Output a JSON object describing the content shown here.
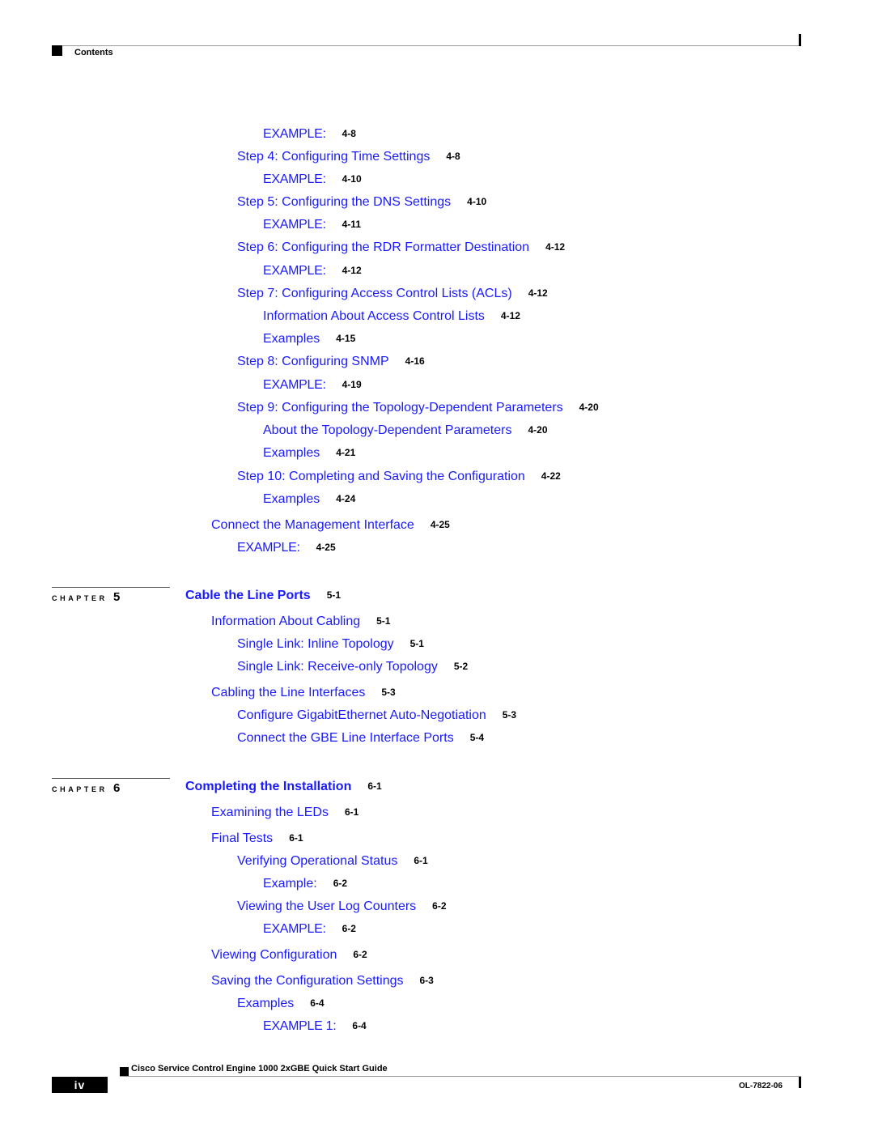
{
  "header": {
    "label": "Contents"
  },
  "toc": [
    {
      "title": "EXAMPLE:",
      "page": "4-8",
      "level": 3,
      "caps": true
    },
    {
      "title": "Step 4: Configuring Time Settings",
      "page": "4-8",
      "level": 2
    },
    {
      "title": "EXAMPLE:",
      "page": "4-10",
      "level": 3,
      "caps": true
    },
    {
      "title": "Step 5: Configuring the DNS Settings",
      "page": "4-10",
      "level": 2
    },
    {
      "title": "EXAMPLE:",
      "page": "4-11",
      "level": 3,
      "caps": true
    },
    {
      "title": "Step 6: Configuring the RDR Formatter Destination",
      "page": "4-12",
      "level": 2
    },
    {
      "title": "EXAMPLE:",
      "page": "4-12",
      "level": 3,
      "caps": true
    },
    {
      "title": "Step 7: Configuring Access Control Lists (ACLs)",
      "page": "4-12",
      "level": 2
    },
    {
      "title": "Information About Access Control Lists",
      "page": "4-12",
      "level": 3
    },
    {
      "title": "Examples",
      "page": "4-15",
      "level": 3
    },
    {
      "title": "Step 8: Configuring SNMP",
      "page": "4-16",
      "level": 2
    },
    {
      "title": "EXAMPLE:",
      "page": "4-19",
      "level": 3,
      "caps": true
    },
    {
      "title": "Step 9: Configuring the Topology-Dependent Parameters",
      "page": "4-20",
      "level": 2
    },
    {
      "title": "About the Topology-Dependent Parameters",
      "page": "4-20",
      "level": 3
    },
    {
      "title": "Examples",
      "page": "4-21",
      "level": 3
    },
    {
      "title": "Step 10: Completing and Saving the Configuration",
      "page": "4-22",
      "level": 2
    },
    {
      "title": "Examples",
      "page": "4-24",
      "level": 3
    },
    {
      "title": "Connect the Management Interface",
      "page": "4-25",
      "level": 1
    },
    {
      "title": "EXAMPLE:",
      "page": "4-25",
      "level": 2,
      "caps": true
    },
    {
      "title": "Cable the Line Ports",
      "page": "5-1",
      "level": 0,
      "chapter": "5"
    },
    {
      "title": "Information About Cabling",
      "page": "5-1",
      "level": 1
    },
    {
      "title": "Single Link: Inline Topology",
      "page": "5-1",
      "level": 2
    },
    {
      "title": "Single Link: Receive-only Topology",
      "page": "5-2",
      "level": 2
    },
    {
      "title": "Cabling the Line Interfaces",
      "page": "5-3",
      "level": 1
    },
    {
      "title": "Configure GigabitEthernet Auto-Negotiation",
      "page": "5-3",
      "level": 2
    },
    {
      "title": "Connect the GBE Line Interface Ports",
      "page": "5-4",
      "level": 2
    },
    {
      "title": "Completing the Installation",
      "page": "6-1",
      "level": 0,
      "chapter": "6"
    },
    {
      "title": "Examining the LEDs",
      "page": "6-1",
      "level": 1
    },
    {
      "title": "Final Tests",
      "page": "6-1",
      "level": 1
    },
    {
      "title": "Verifying Operational Status",
      "page": "6-1",
      "level": 2
    },
    {
      "title": "Example:",
      "page": "6-2",
      "level": 3
    },
    {
      "title": "Viewing the User Log Counters",
      "page": "6-2",
      "level": 2
    },
    {
      "title": "EXAMPLE:",
      "page": "6-2",
      "level": 3,
      "caps": true
    },
    {
      "title": "Viewing Configuration",
      "page": "6-2",
      "level": 1
    },
    {
      "title": "Saving the Configuration Settings",
      "page": "6-3",
      "level": 1
    },
    {
      "title": "Examples",
      "page": "6-4",
      "level": 2
    },
    {
      "title": "EXAMPLE 1:",
      "page": "6-4",
      "level": 3,
      "caps": true
    }
  ],
  "chapter_label": "CHAPTER",
  "footer": {
    "title": "Cisco Service Control Engine 1000 2xGBE Quick Start Guide",
    "page_number": "iv",
    "doc_number": "OL-7822-06"
  },
  "colors": {
    "link": "#1a1aff",
    "text": "#000000"
  }
}
